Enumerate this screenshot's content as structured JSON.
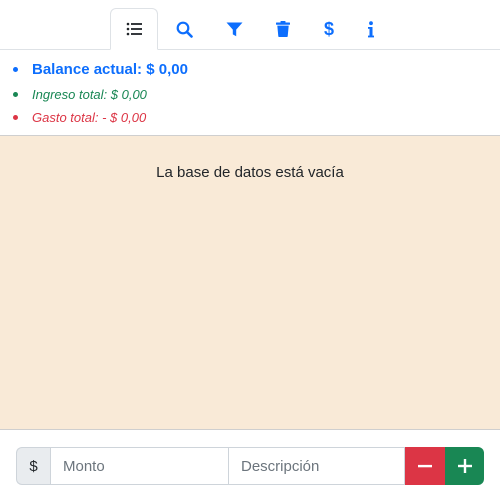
{
  "tabs": [
    {
      "icon": "list-icon",
      "active": true
    },
    {
      "icon": "search-icon",
      "active": false
    },
    {
      "icon": "filter-icon",
      "active": false
    },
    {
      "icon": "trash-icon",
      "active": false
    },
    {
      "icon": "dollar-icon",
      "active": false
    },
    {
      "icon": "info-icon",
      "active": false
    }
  ],
  "summary": {
    "balance": "Balance actual: $ 0,00",
    "ingreso": "Ingreso total: $ 0,00",
    "gasto": "Gasto total: - $ 0,00"
  },
  "list": {
    "empty_message": "La base de datos está vacía"
  },
  "form": {
    "currency_symbol": "$",
    "amount_placeholder": "Monto",
    "description_placeholder": "Descripción"
  },
  "colors": {
    "primary": "#0d6efd",
    "income": "#198754",
    "expense": "#dc3545",
    "list_background": "#f9ead7"
  }
}
